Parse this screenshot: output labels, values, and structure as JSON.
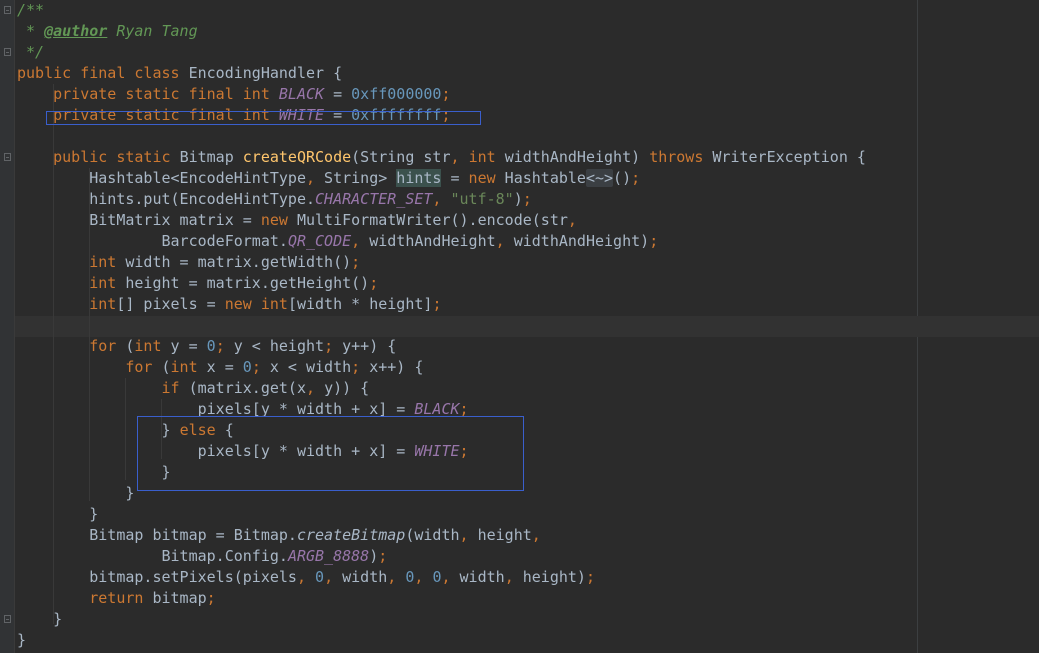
{
  "editor": {
    "colors": {
      "background": "#2b2b2b",
      "keyword": "#cc7832",
      "constant": "#9876aa",
      "number": "#6897bb",
      "string": "#6a8759",
      "method": "#ffc66d",
      "comment": "#629755",
      "text": "#a9b7c6",
      "selection_box": "#3a5fcd"
    },
    "lines": [
      [
        {
          "t": "/**",
          "c": "cm"
        }
      ],
      [
        {
          "t": " * ",
          "c": "cm"
        },
        {
          "t": "@author",
          "c": "cm-tag"
        },
        {
          "t": " Ryan Tang",
          "c": "cm"
        }
      ],
      [
        {
          "t": " */",
          "c": "cm"
        }
      ],
      [
        {
          "t": "public final class ",
          "c": "kw"
        },
        {
          "t": "EncodingHandler {"
        }
      ],
      [
        {
          "t": "    "
        },
        {
          "t": "private static final int ",
          "c": "kw"
        },
        {
          "t": "BLACK",
          "c": "const"
        },
        {
          "t": " = "
        },
        {
          "t": "0xff000000",
          "c": "num"
        },
        {
          "t": ";",
          "c": "kw"
        }
      ],
      [
        {
          "t": "    "
        },
        {
          "t": "private static final int ",
          "c": "kw"
        },
        {
          "t": "WHITE",
          "c": "const"
        },
        {
          "t": " = "
        },
        {
          "t": "0xffffffff",
          "c": "num"
        },
        {
          "t": ";",
          "c": "kw"
        }
      ],
      [],
      [
        {
          "t": "    "
        },
        {
          "t": "public static ",
          "c": "kw"
        },
        {
          "t": "Bitmap "
        },
        {
          "t": "createQRCode",
          "c": "fn"
        },
        {
          "t": "(String str"
        },
        {
          "t": ", ",
          "c": "kw"
        },
        {
          "t": "int ",
          "c": "kw"
        },
        {
          "t": "widthAndHeight) "
        },
        {
          "t": "throws ",
          "c": "kw"
        },
        {
          "t": "WriterException {"
        }
      ],
      [
        {
          "t": "        Hashtable<EncodeHintType"
        },
        {
          "t": ", ",
          "c": "kw"
        },
        {
          "t": "String> "
        },
        {
          "t": "hints",
          "c": "hl-var"
        },
        {
          "t": " = "
        },
        {
          "t": "new ",
          "c": "kw"
        },
        {
          "t": "Hashtable"
        },
        {
          "t": "<~>",
          "c": "fold-ph"
        },
        {
          "t": "()"
        },
        {
          "t": ";",
          "c": "kw"
        }
      ],
      [
        {
          "t": "        hints.put(EncodeHintType."
        },
        {
          "t": "CHARACTER_SET",
          "c": "const"
        },
        {
          "t": ", ",
          "c": "kw"
        },
        {
          "t": "\"utf-8\"",
          "c": "str"
        },
        {
          "t": ")"
        },
        {
          "t": ";",
          "c": "kw"
        }
      ],
      [
        {
          "t": "        BitMatrix matrix = "
        },
        {
          "t": "new ",
          "c": "kw"
        },
        {
          "t": "MultiFormatWriter().encode(str"
        },
        {
          "t": ",",
          "c": "kw"
        }
      ],
      [
        {
          "t": "                BarcodeFormat."
        },
        {
          "t": "QR_CODE",
          "c": "const"
        },
        {
          "t": ", ",
          "c": "kw"
        },
        {
          "t": "widthAndHeight"
        },
        {
          "t": ", ",
          "c": "kw"
        },
        {
          "t": "widthAndHeight)"
        },
        {
          "t": ";",
          "c": "kw"
        }
      ],
      [
        {
          "t": "        "
        },
        {
          "t": "int ",
          "c": "kw"
        },
        {
          "t": "width = matrix.getWidth()"
        },
        {
          "t": ";",
          "c": "kw"
        }
      ],
      [
        {
          "t": "        "
        },
        {
          "t": "int ",
          "c": "kw"
        },
        {
          "t": "height = matrix.getHeight()"
        },
        {
          "t": ";",
          "c": "kw"
        }
      ],
      [
        {
          "t": "        "
        },
        {
          "t": "int",
          "c": "kw"
        },
        {
          "t": "[] pixels = "
        },
        {
          "t": "new int",
          "c": "kw"
        },
        {
          "t": "[width * height]"
        },
        {
          "t": ";",
          "c": "kw"
        }
      ],
      [],
      [
        {
          "t": "        "
        },
        {
          "t": "for ",
          "c": "kw"
        },
        {
          "t": "("
        },
        {
          "t": "int ",
          "c": "kw"
        },
        {
          "t": "y = "
        },
        {
          "t": "0",
          "c": "num"
        },
        {
          "t": "; ",
          "c": "kw"
        },
        {
          "t": "y < height"
        },
        {
          "t": "; ",
          "c": "kw"
        },
        {
          "t": "y++) {"
        }
      ],
      [
        {
          "t": "            "
        },
        {
          "t": "for ",
          "c": "kw"
        },
        {
          "t": "("
        },
        {
          "t": "int ",
          "c": "kw"
        },
        {
          "t": "x = "
        },
        {
          "t": "0",
          "c": "num"
        },
        {
          "t": "; ",
          "c": "kw"
        },
        {
          "t": "x < width"
        },
        {
          "t": "; ",
          "c": "kw"
        },
        {
          "t": "x++) {"
        }
      ],
      [
        {
          "t": "                "
        },
        {
          "t": "if ",
          "c": "kw"
        },
        {
          "t": "(matrix.get(x"
        },
        {
          "t": ", ",
          "c": "kw"
        },
        {
          "t": "y)) {"
        }
      ],
      [
        {
          "t": "                    pixels[y * width + x] = "
        },
        {
          "t": "BLACK",
          "c": "const"
        },
        {
          "t": ";",
          "c": "kw"
        }
      ],
      [
        {
          "t": "                } "
        },
        {
          "t": "else ",
          "c": "kw"
        },
        {
          "t": "{"
        }
      ],
      [
        {
          "t": "                    pixels[y * width + x] = "
        },
        {
          "t": "WHITE",
          "c": "const"
        },
        {
          "t": ";",
          "c": "kw"
        }
      ],
      [
        {
          "t": "                }"
        }
      ],
      [
        {
          "t": "            }"
        }
      ],
      [
        {
          "t": "        }"
        }
      ],
      [
        {
          "t": "        Bitmap bitmap = Bitmap."
        },
        {
          "t": "createBitmap",
          "c": "static-call"
        },
        {
          "t": "(width"
        },
        {
          "t": ", ",
          "c": "kw"
        },
        {
          "t": "height"
        },
        {
          "t": ",",
          "c": "kw"
        }
      ],
      [
        {
          "t": "                Bitmap.Config."
        },
        {
          "t": "ARGB_8888",
          "c": "const"
        },
        {
          "t": ")"
        },
        {
          "t": ";",
          "c": "kw"
        }
      ],
      [
        {
          "t": "        bitmap.setPixels(pixels"
        },
        {
          "t": ", ",
          "c": "kw"
        },
        {
          "t": "0",
          "c": "num"
        },
        {
          "t": ", ",
          "c": "kw"
        },
        {
          "t": "width"
        },
        {
          "t": ", ",
          "c": "kw"
        },
        {
          "t": "0",
          "c": "num"
        },
        {
          "t": ", ",
          "c": "kw"
        },
        {
          "t": "0",
          "c": "num"
        },
        {
          "t": ", ",
          "c": "kw"
        },
        {
          "t": "width"
        },
        {
          "t": ", ",
          "c": "kw"
        },
        {
          "t": "height)"
        },
        {
          "t": ";",
          "c": "kw"
        }
      ],
      [
        {
          "t": "        "
        },
        {
          "t": "return ",
          "c": "kw"
        },
        {
          "t": "bitmap"
        },
        {
          "t": ";",
          "c": "kw"
        }
      ],
      [
        {
          "t": "    }"
        }
      ],
      [
        {
          "t": "}"
        }
      ]
    ]
  }
}
